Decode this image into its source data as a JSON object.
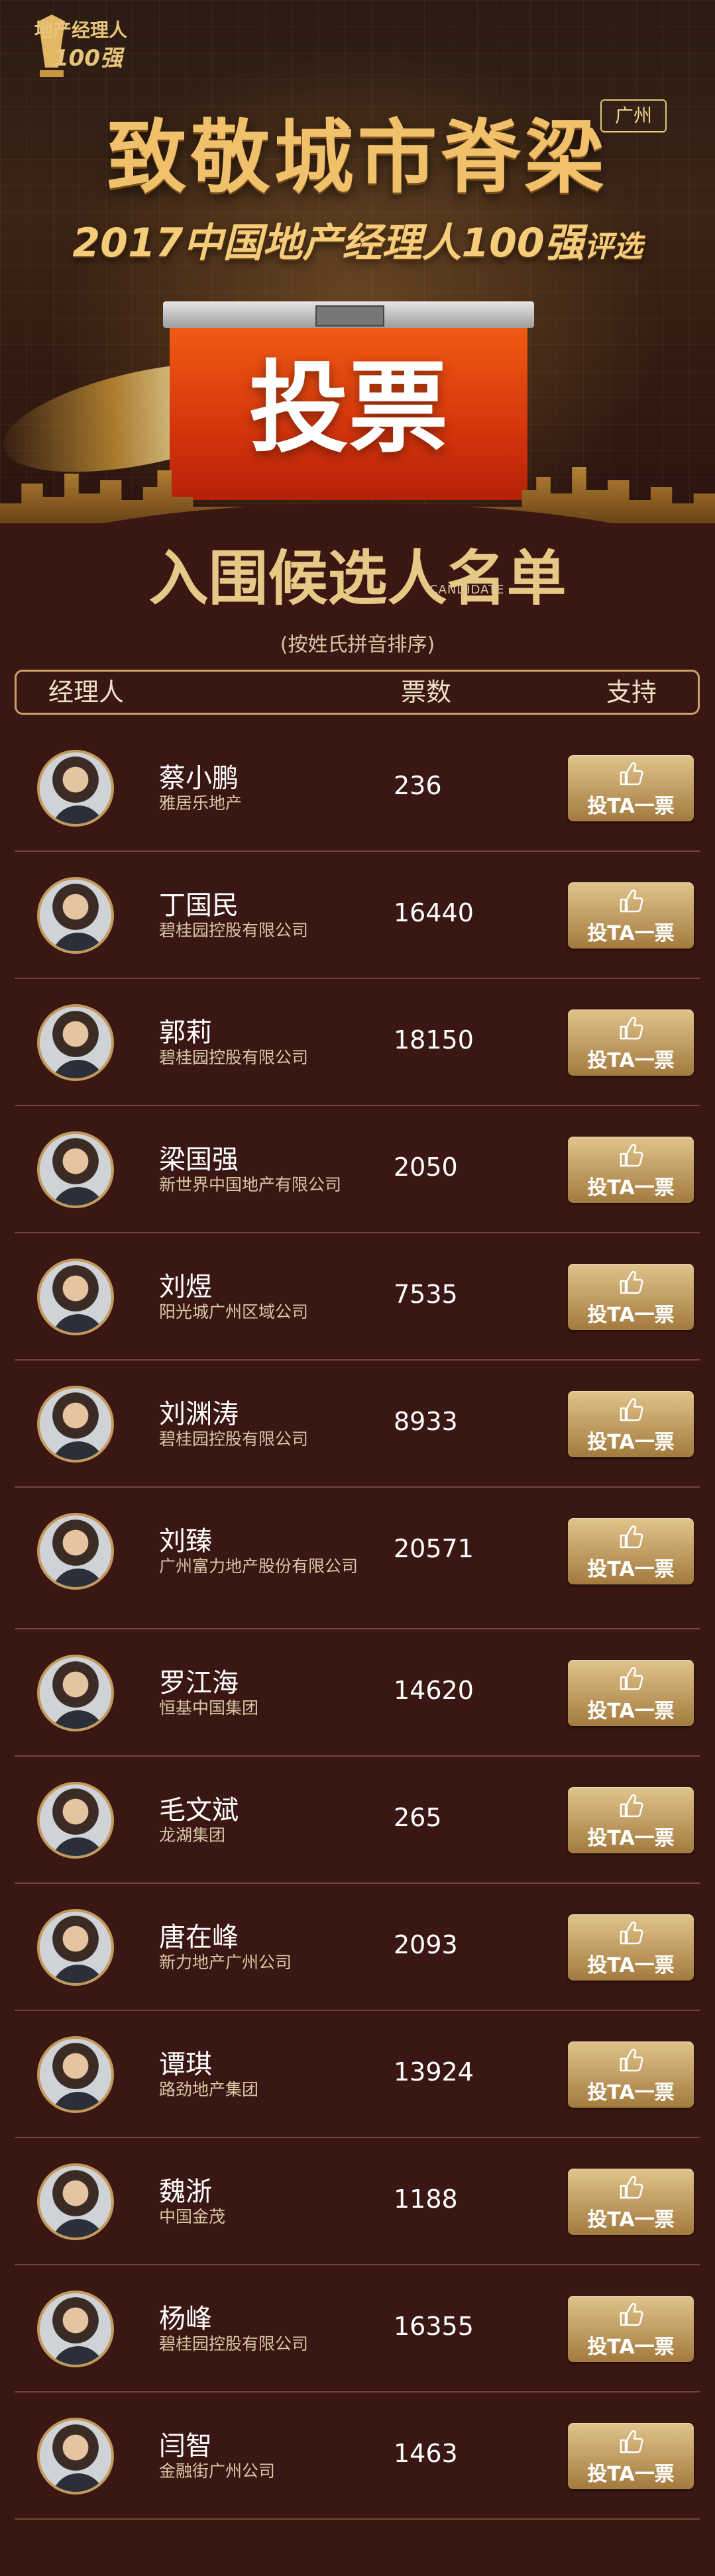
{
  "header": {
    "logo_line1": "地产经理人",
    "logo_line2": "100强",
    "main_title": "致敬城市脊梁",
    "city_badge": "广州",
    "subtitle": "2017中国地产经理人100强",
    "subtitle_suffix": "评选",
    "ballot_label": "投票"
  },
  "section": {
    "title": "入围候选人名单",
    "title_en": "CANDIDATE",
    "sort_note": "(按姓氏拼音排序)"
  },
  "table": {
    "col_manager": "经理人",
    "col_votes": "票数",
    "col_support": "支持"
  },
  "vote_button_label": "投TA一票",
  "candidates": [
    {
      "name": "蔡小鹏",
      "company": "雅居乐地产",
      "votes": "236"
    },
    {
      "name": "丁国民",
      "company": "碧桂园控股有限公司",
      "votes": "16440"
    },
    {
      "name": "郭莉",
      "company": "碧桂园控股有限公司",
      "votes": "18150"
    },
    {
      "name": "梁国强",
      "company": "新世界中国地产有限公司",
      "votes": "2050"
    },
    {
      "name": "刘煜",
      "company": "阳光城广州区域公司",
      "votes": "7535"
    },
    {
      "name": "刘渊涛",
      "company": "碧桂园控股有限公司",
      "votes": "8933"
    },
    {
      "name": "刘臻",
      "company": "广州富力地产股份有限公司",
      "votes": "20571"
    },
    {
      "name": "罗江海",
      "company": "恒基中国集团",
      "votes": "14620"
    },
    {
      "name": "毛文斌",
      "company": "龙湖集团",
      "votes": "265"
    },
    {
      "name": "唐在峰",
      "company": "新力地产广州公司",
      "votes": "2093"
    },
    {
      "name": "谭琪",
      "company": "路劲地产集团",
      "votes": "13924"
    },
    {
      "name": "魏浙",
      "company": "中国金茂",
      "votes": "1188"
    },
    {
      "name": "杨峰",
      "company": "碧桂园控股有限公司",
      "votes": "16355"
    },
    {
      "name": "闫智",
      "company": "金融街广州公司",
      "votes": "1463"
    }
  ]
}
